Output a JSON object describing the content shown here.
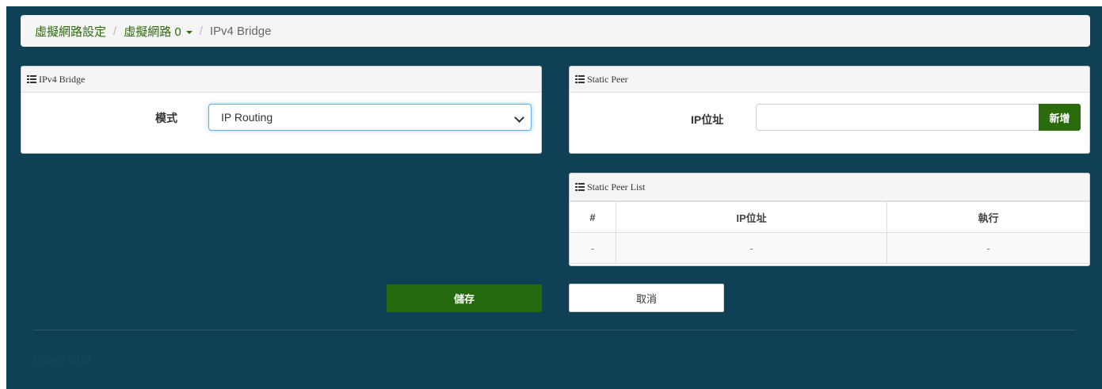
{
  "breadcrumb": {
    "items": [
      "虛擬網路設定",
      "虛擬網路 0"
    ],
    "separator": "/",
    "current": "IPv4 Bridge"
  },
  "bridge_panel": {
    "title": "IPv4 Bridge",
    "mode_label": "模式",
    "mode_value": "IP Routing"
  },
  "peer_panel": {
    "title": "Static Peer",
    "ip_label": "IP位址",
    "ip_value": "",
    "add_label": "新增"
  },
  "peer_list": {
    "title": "Static Peer List",
    "columns": [
      "#",
      "IP位址",
      "執行"
    ],
    "rows": [
      [
        "-",
        "-",
        "-"
      ]
    ]
  },
  "actions": {
    "save_label": "儲存",
    "cancel_label": "取消"
  },
  "footer": {
    "copyright": "Copy© 2019"
  },
  "colors": {
    "background": "#0f4055",
    "accent_green": "#24690d",
    "link_green": "#2e6b0f"
  }
}
